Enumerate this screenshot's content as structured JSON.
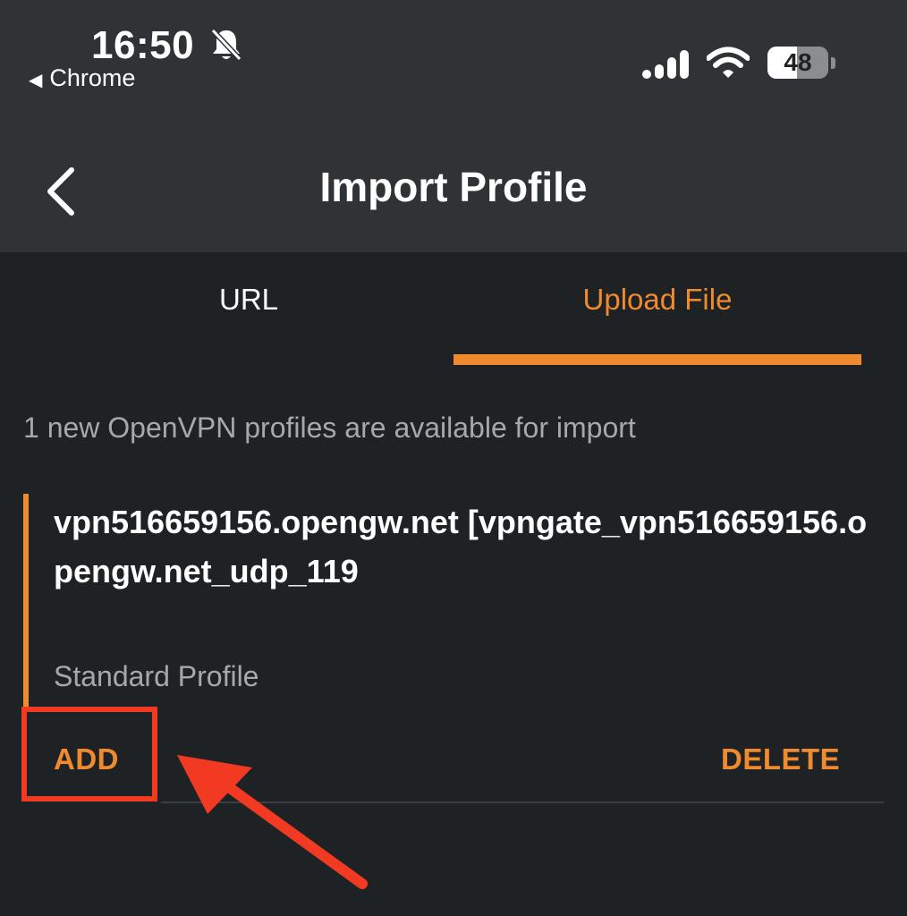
{
  "status_bar": {
    "time": "16:50",
    "back_app": "Chrome",
    "battery_level": "48",
    "battery_fraction": 0.48
  },
  "header": {
    "title": "Import Profile"
  },
  "tabs": [
    {
      "label": "URL",
      "selected": false
    },
    {
      "label": "Upload File",
      "selected": true
    }
  ],
  "info_text": "1 new OpenVPN profiles are available for import",
  "profile": {
    "name": "vpn516659156.opengw.net [vpngate_vpn516659156.opengw.net_udp_119",
    "type": "Standard Profile",
    "add_label": "ADD",
    "delete_label": "DELETE"
  },
  "colors": {
    "accent": "#ef8a2e",
    "annotation": "#f23a22",
    "header_bg": "#2f3336",
    "content_bg": "#1e2225"
  },
  "icons": [
    "bell-slash-icon",
    "signal-icon",
    "wifi-icon",
    "battery-icon",
    "chevron-left-icon"
  ]
}
